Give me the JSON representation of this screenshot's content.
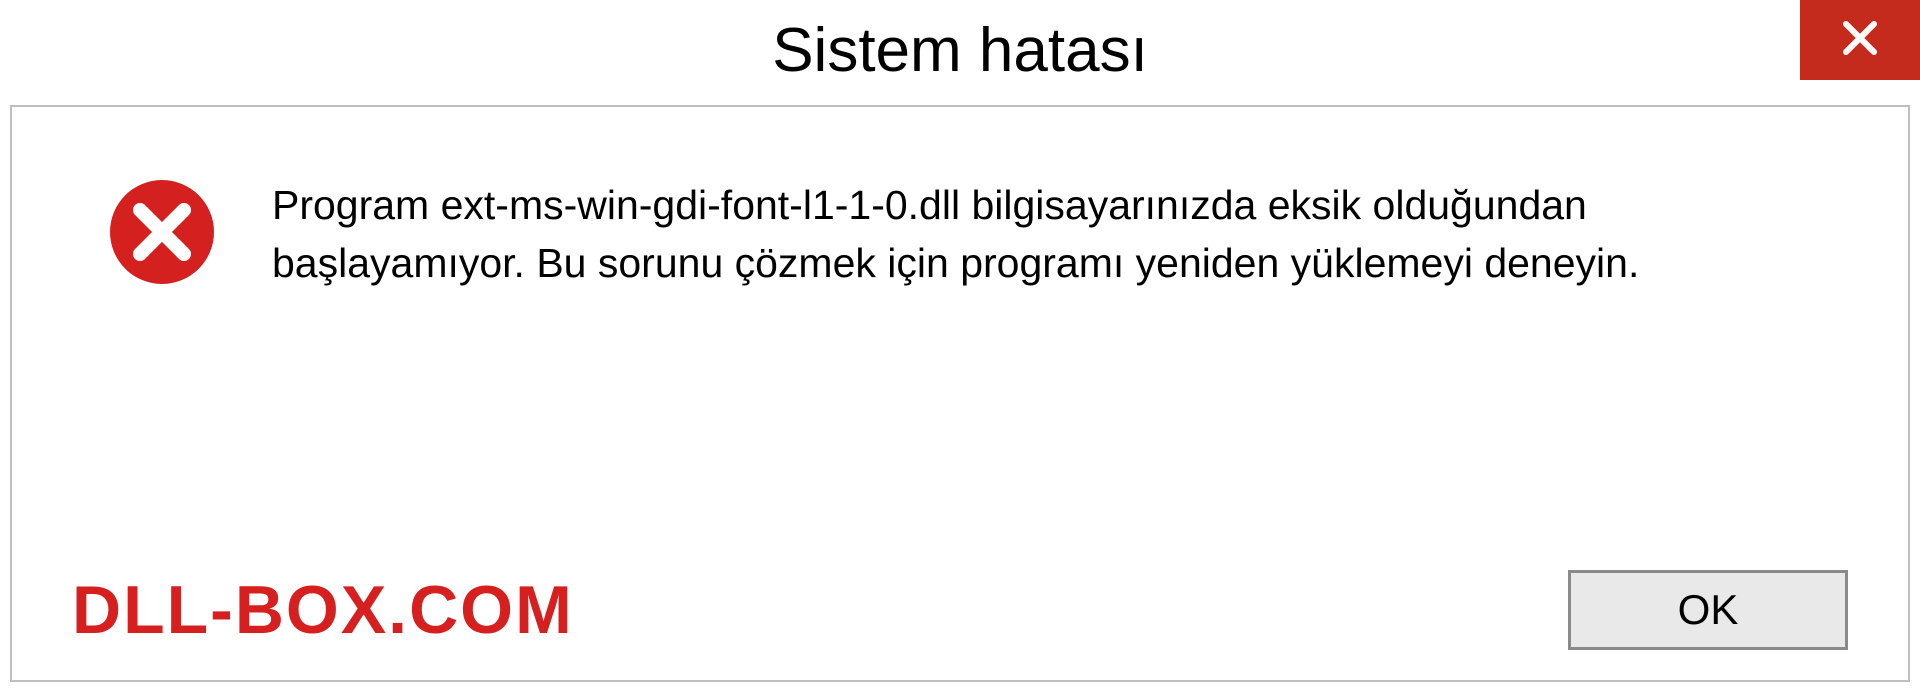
{
  "titlebar": {
    "title": "Sistem hatası"
  },
  "message": {
    "text": "Program ext-ms-win-gdi-font-l1-1-0.dll bilgisayarınızda eksik olduğundan başlayamıyor. Bu sorunu çözmek için programı yeniden yüklemeyi deneyin."
  },
  "footer": {
    "watermark": "DLL-BOX.COM",
    "ok_label": "OK"
  },
  "colors": {
    "close_button": "#c42b1c",
    "watermark": "#d62020",
    "error_icon": "#d52020"
  }
}
